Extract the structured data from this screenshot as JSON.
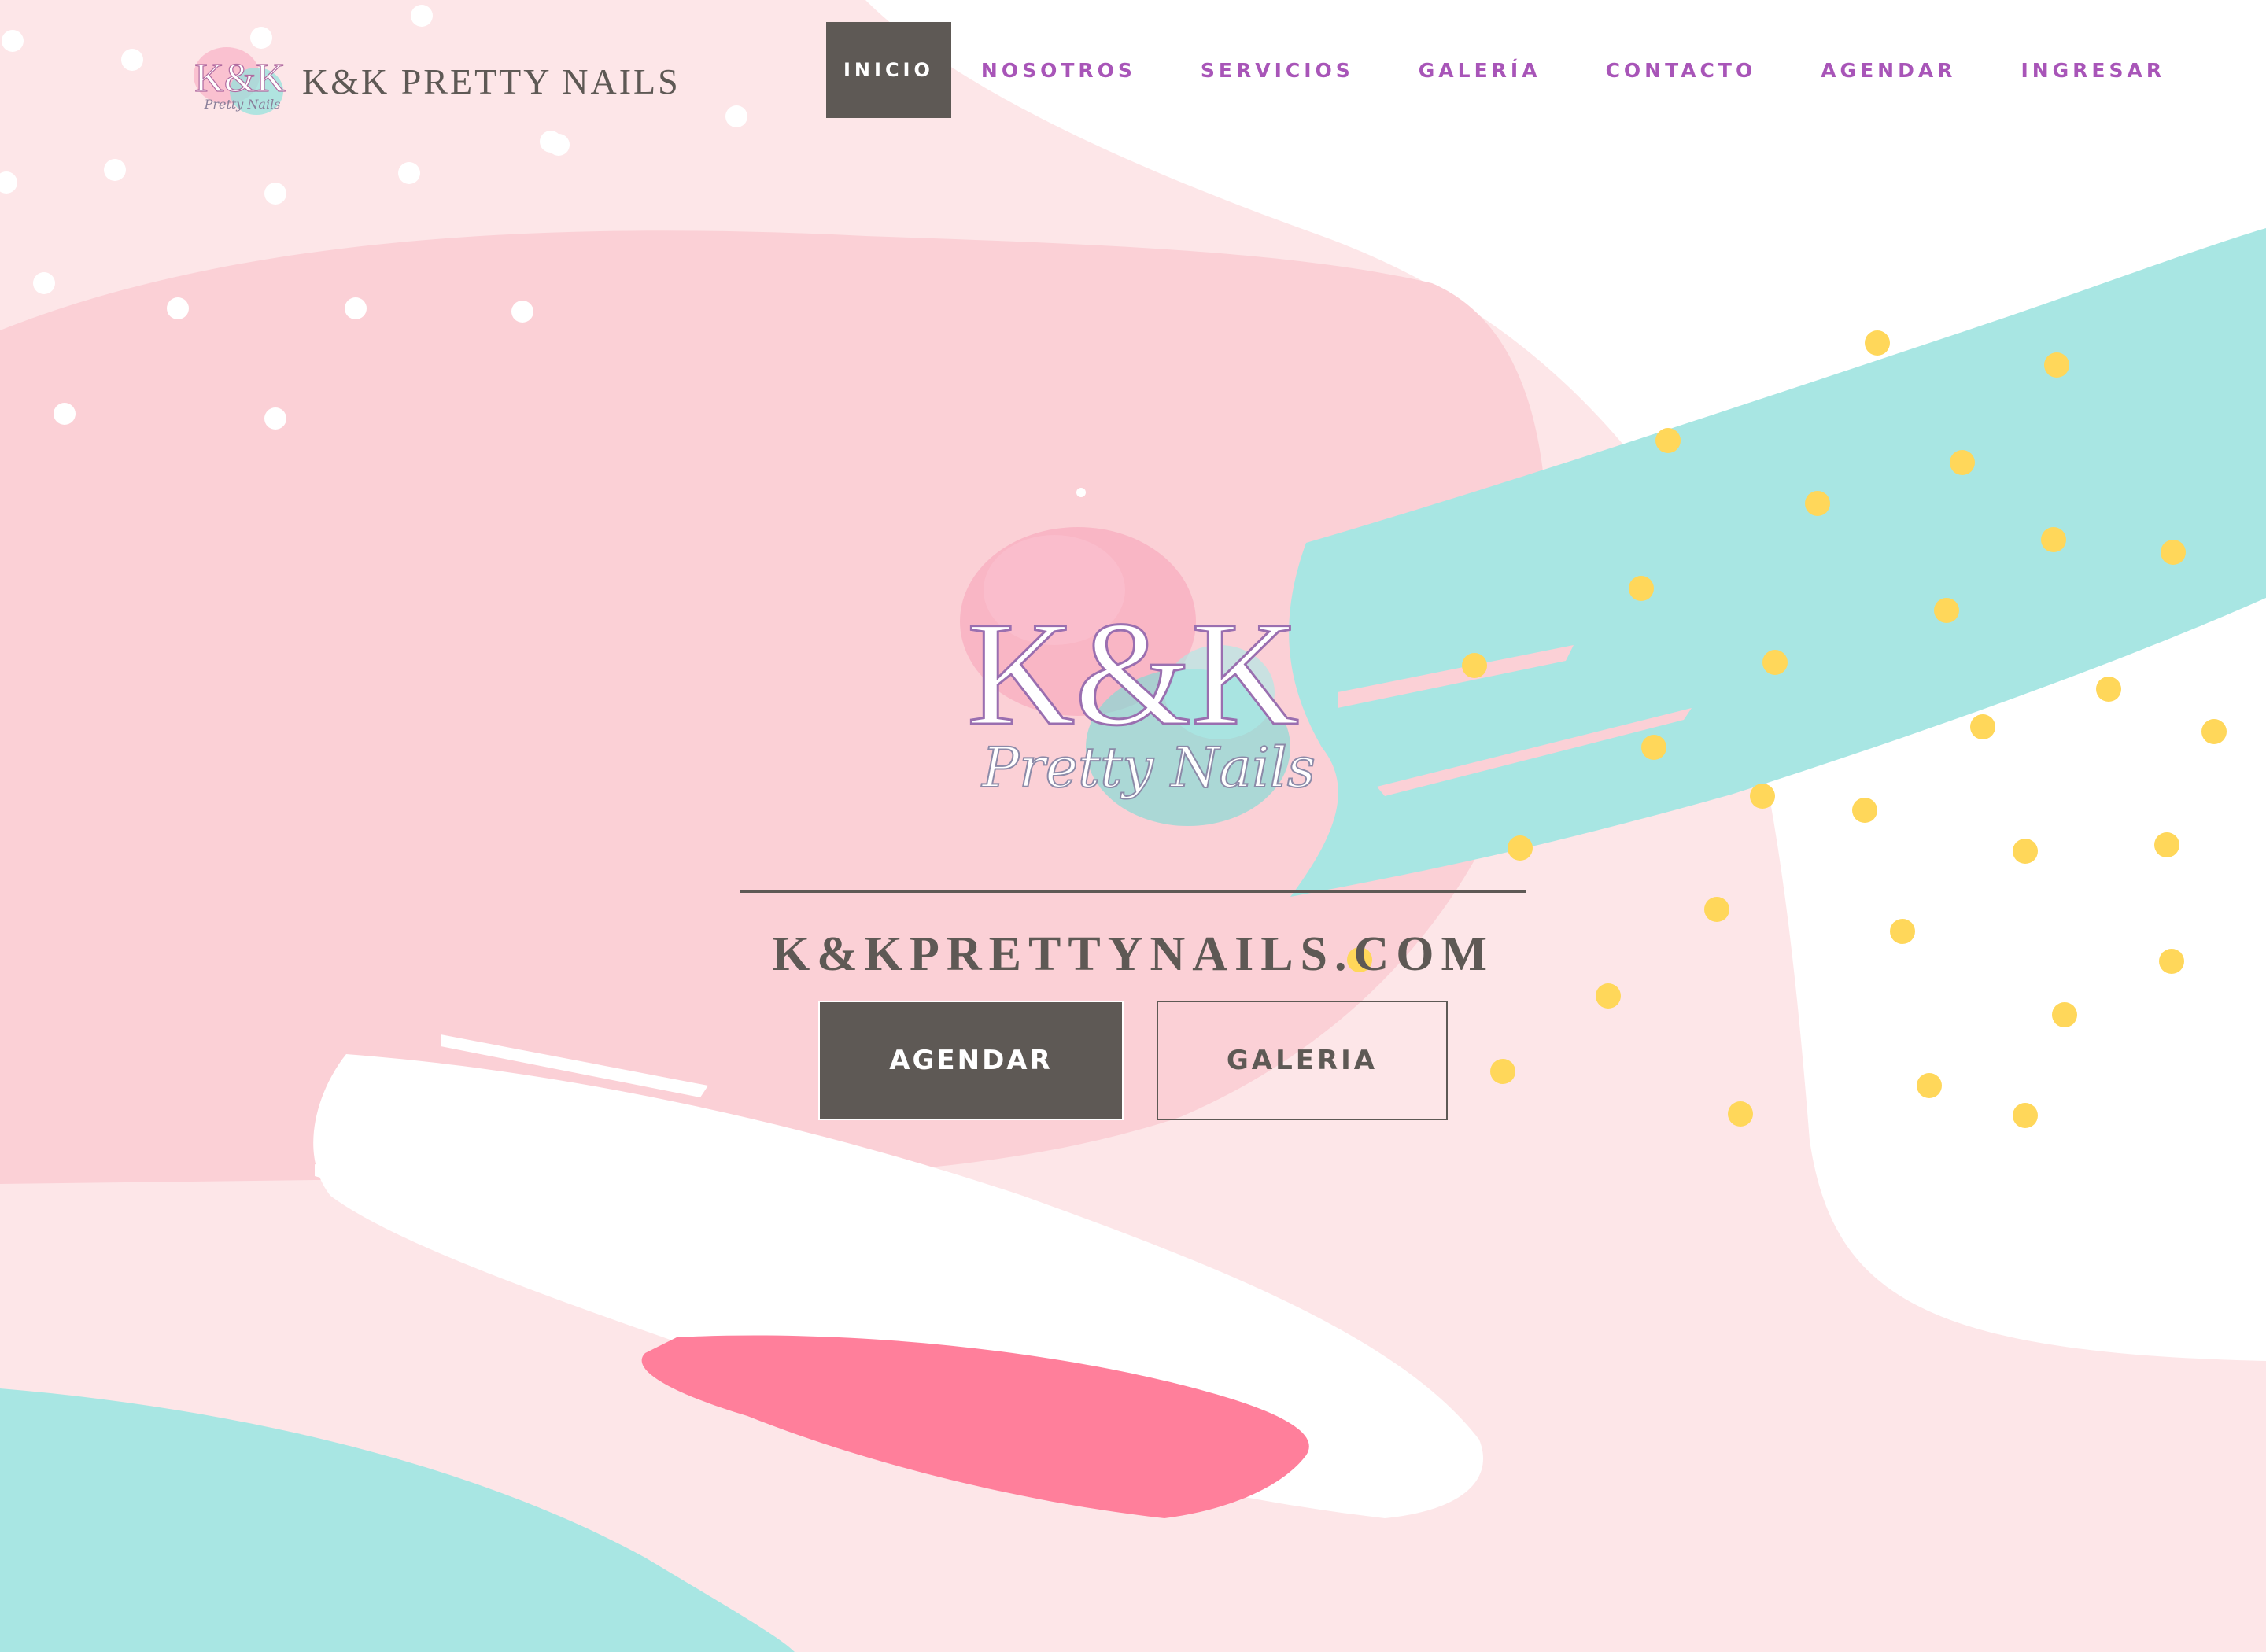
{
  "brand": {
    "name": "K&K PRETTY NAILS",
    "logo_icon": "kk-pretty-nails-logo"
  },
  "nav": {
    "items": [
      {
        "label": "INICIO",
        "active": true
      },
      {
        "label": "NOSOTROS",
        "active": false
      },
      {
        "label": "SERVICIOS",
        "active": false
      },
      {
        "label": "GALERÍA",
        "active": false
      },
      {
        "label": "CONTACTO",
        "active": false
      },
      {
        "label": "AGENDAR",
        "active": false
      },
      {
        "label": "INGRESAR",
        "active": false
      }
    ]
  },
  "hero": {
    "logo_big": "K&K",
    "logo_script": "Pretty Nails",
    "domain": "K&KPRETTYNAILS.COM",
    "primary_button": "AGENDAR",
    "secondary_button": "GALERIA"
  },
  "colors": {
    "accent_nav": "#a855b8",
    "dark": "#5e5955",
    "pink_light": "#fde6e8",
    "pink_mid": "#fbd0d6",
    "pink_hot": "#ff7f9b",
    "teal": "#a8e6e3",
    "yellow_dot": "#ffd75a"
  }
}
